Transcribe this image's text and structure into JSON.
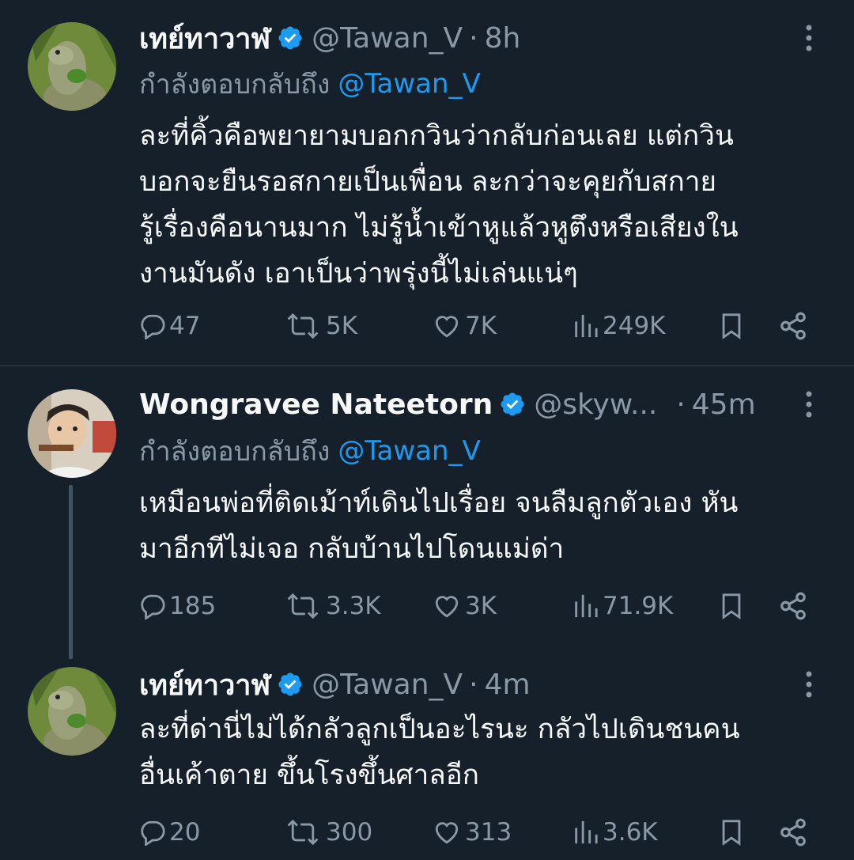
{
  "tweets": [
    {
      "name": "เทย์ทาวาฬ",
      "handle": "@Tawan_V",
      "dot": "·",
      "time": "8h",
      "reply_prefix": "กำลังตอบกลับถึง",
      "reply_to": "@Tawan_V",
      "lines": [
        "ละที่คิ้วคือพยายามบอกกวินว่ากลับก่อนเลย แต่กวิน",
        "บอกจะยืนรอสกายเป็นเพื่อน ละกว่าจะคุยกับสกาย",
        "รู้เรื่องคือนานมาก ไม่รู้น้ำเข้าหูแล้วหูตึงหรือเสียงใน",
        "งานมันดัง เอาเป็นว่าพรุ่งนี้ไม่เล่นแน่ๆ"
      ],
      "replies": "47",
      "retweets": "5K",
      "likes": "7K",
      "views": "249K"
    },
    {
      "name": "Wongravee Nateetorn",
      "handle": "@skyw...",
      "dot": "·",
      "time": "45m",
      "reply_prefix": "กำลังตอบกลับถึง",
      "reply_to": "@Tawan_V",
      "lines": [
        "เหมือนพ่อที่ติดเม้าท์เดินไปเรื่อย จนลืมลูกตัวเอง หัน",
        "มาอีกทีไม่เจอ กลับบ้านไปโดนแม่ด่า"
      ],
      "replies": "185",
      "retweets": "3.3K",
      "likes": "3K",
      "views": "71.9K"
    },
    {
      "name": "เทย์ทาวาฬ",
      "handle": "@Tawan_V",
      "dot": "·",
      "time": "4m",
      "lines": [
        "ละที่ด่านี่ไม่ได้กลัวลูกเป็นอะไรนะ กลัวไปเดินชนคน",
        "อื่นเค้าตาย ขึ้นโรงขึ้นศาลอีก"
      ],
      "replies": "20",
      "retweets": "300",
      "likes": "313",
      "views": "3.6K"
    }
  ],
  "colors": {
    "background": "#15202b",
    "text": "#f7f9f9",
    "secondary": "#8b98a5",
    "mention": "#1d9bf0",
    "verified": "#1d9bf0",
    "divider": "#38444d"
  }
}
